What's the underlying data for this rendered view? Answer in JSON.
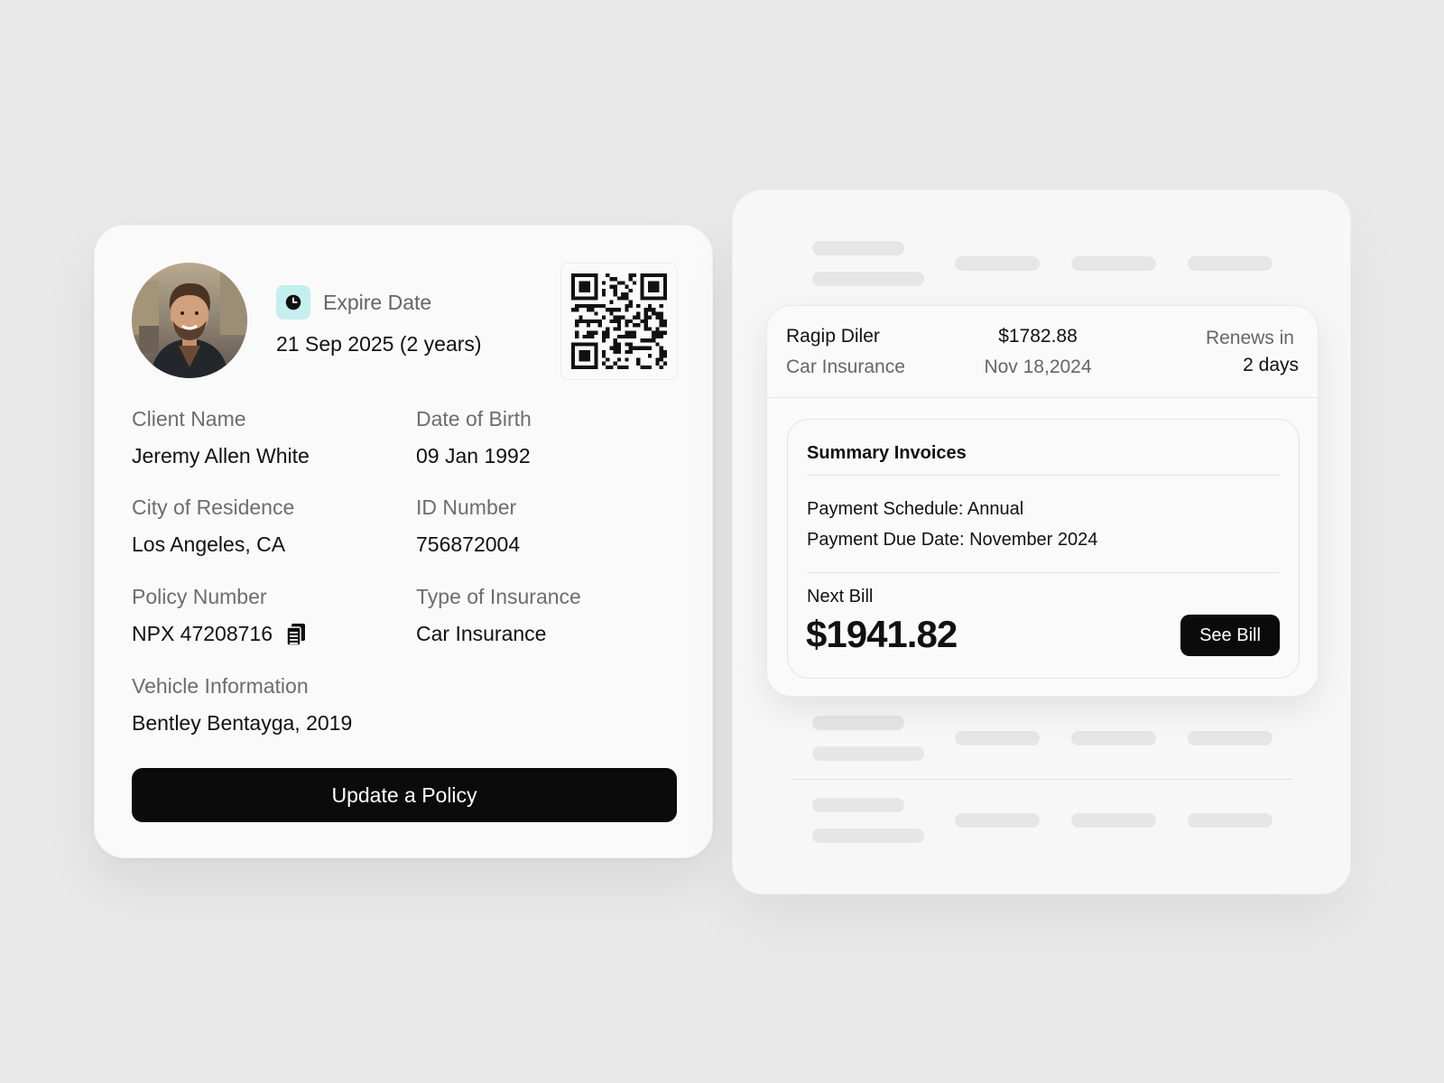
{
  "policy_card": {
    "expire_label": "Expire Date",
    "expire_value": "21 Sep 2025 (2 years)",
    "fields": {
      "client_name": {
        "label": "Client Name",
        "value": "Jeremy Allen White"
      },
      "date_of_birth": {
        "label": "Date of Birth",
        "value": "09 Jan 1992"
      },
      "city": {
        "label": "City of Residence",
        "value": "Los Angeles, CA"
      },
      "id_number": {
        "label": "ID Number",
        "value": "756872004"
      },
      "policy_number": {
        "label": "Policy Number",
        "value": "NPX 47208716"
      },
      "insurance_type": {
        "label": "Type of Insurance",
        "value": "Car Insurance"
      },
      "vehicle": {
        "label": "Vehicle Information",
        "value": "Bentley Bentayga, 2019"
      }
    },
    "update_button": "Update a Policy",
    "icons": {
      "expire": "clock-icon",
      "policy_copy": "copy-icon",
      "qr": "qr-code-icon"
    },
    "accent_color": "#c5eeee"
  },
  "policy_row": {
    "name": "Ragip Diler",
    "type": "Car Insurance",
    "amount": "$1782.88",
    "date": "Nov 18,2024",
    "renews_label": "Renews in",
    "renews_value": "2 days"
  },
  "summary": {
    "title": "Summary Invoices",
    "schedule": "Payment Schedule: Annual",
    "due_date": "Payment Due Date: November 2024",
    "next_bill_label": "Next Bill",
    "next_bill_amount": "$1941.82",
    "see_bill_button": "See Bill"
  }
}
